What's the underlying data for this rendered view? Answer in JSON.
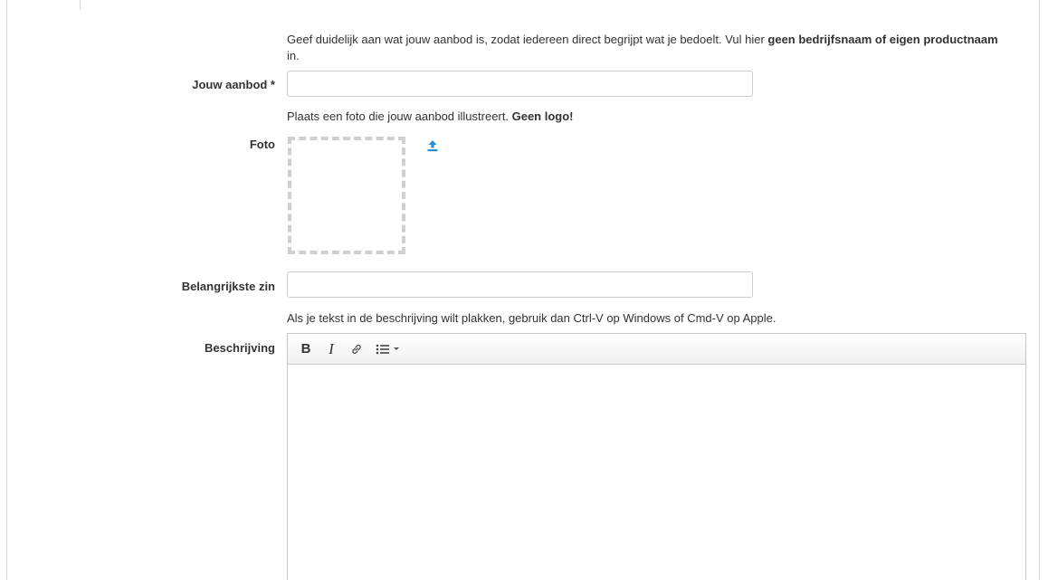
{
  "form": {
    "offer_hint_prefix": "Geef duidelijk aan wat jouw aanbod is, zodat iedereen direct begrijpt wat je bedoelt. Vul hier ",
    "offer_hint_bold": "geen bedrijfsnaam of eigen productnaam",
    "offer_hint_suffix": " in.",
    "offer_label": "Jouw aanbod *",
    "offer_value": "",
    "photo_hint_prefix": "Plaats een foto die jouw aanbod illustreert. ",
    "photo_hint_bold": "Geen logo!",
    "photo_label": "Foto",
    "sentence_label": "Belangrijkste zin",
    "sentence_value": "",
    "description_hint": "Als je tekst in de beschrijving wilt plakken, gebruik dan Ctrl-V op Windows of Cmd-V op Apple.",
    "description_label": "Beschrijving"
  },
  "editor": {
    "bold_label": "B",
    "italic_label": "I",
    "icons": [
      "link-icon",
      "bullet-list-icon",
      "chevron-down-icon",
      "upload-icon"
    ]
  },
  "colors": {
    "accent": "#2a8bd6",
    "border": "#cccccc",
    "dashed": "#cfcfcf",
    "text": "#333333"
  }
}
